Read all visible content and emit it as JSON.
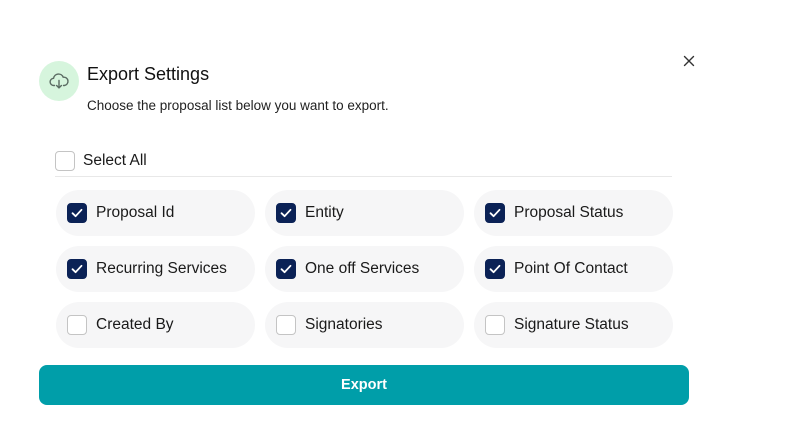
{
  "dialog": {
    "title": "Export Settings",
    "subtitle": "Choose the proposal list below you want to export.",
    "header_icon": "cloud-download-icon",
    "close_icon": "close-icon"
  },
  "select_all": {
    "label": "Select All",
    "checked": false
  },
  "options": [
    {
      "label": "Proposal Id",
      "checked": true
    },
    {
      "label": "Entity",
      "checked": true
    },
    {
      "label": "Proposal Status",
      "checked": true
    },
    {
      "label": "Recurring Services",
      "checked": true
    },
    {
      "label": "One off Services",
      "checked": true
    },
    {
      "label": "Point Of Contact",
      "checked": true
    },
    {
      "label": "Created By",
      "checked": false
    },
    {
      "label": "Signatories",
      "checked": false
    },
    {
      "label": "Signature Status",
      "checked": false
    }
  ],
  "export_button": {
    "label": "Export"
  },
  "colors": {
    "accent": "#009ea9",
    "checkbox_checked": "#0b2256",
    "icon_bg": "#d6f5dd",
    "option_bg": "#f6f6f7"
  }
}
